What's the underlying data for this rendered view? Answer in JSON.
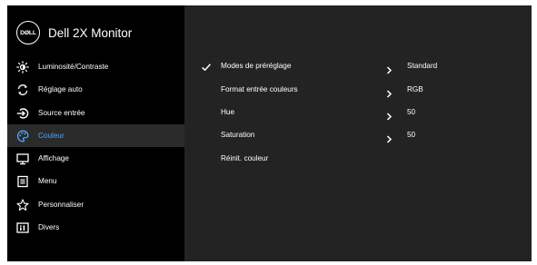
{
  "header": {
    "logo_text": "DØLL",
    "title": "Dell 2X Monitor"
  },
  "menu": [
    {
      "label": "Luminosité/Contraste",
      "icon": "brightness-icon"
    },
    {
      "label": "Réglage auto",
      "icon": "auto-adjust-icon"
    },
    {
      "label": "Source entrée",
      "icon": "input-source-icon"
    },
    {
      "label": "Couleur",
      "icon": "color-palette-icon",
      "active": true
    },
    {
      "label": "Affichage",
      "icon": "display-icon"
    },
    {
      "label": "Menu",
      "icon": "menu-icon"
    },
    {
      "label": "Personnaliser",
      "icon": "star-icon"
    },
    {
      "label": "Divers",
      "icon": "info-icon"
    }
  ],
  "content": {
    "rows": [
      {
        "label": "Modes de préréglage",
        "value": "Standard",
        "checked": true,
        "chevron": true
      },
      {
        "label": "Format entrée couleurs",
        "value": "RGB",
        "chevron": true
      },
      {
        "label": "Hue",
        "value": "50",
        "chevron": true
      },
      {
        "label": "Saturation",
        "value": "50",
        "chevron": true
      },
      {
        "label": "Réinit. couleur",
        "value": ""
      }
    ]
  },
  "colors": {
    "background": "#000000",
    "panel": "#232323",
    "active_row": "#2b2b2b",
    "accent": "#4da3ff",
    "text": "#ffffff"
  }
}
